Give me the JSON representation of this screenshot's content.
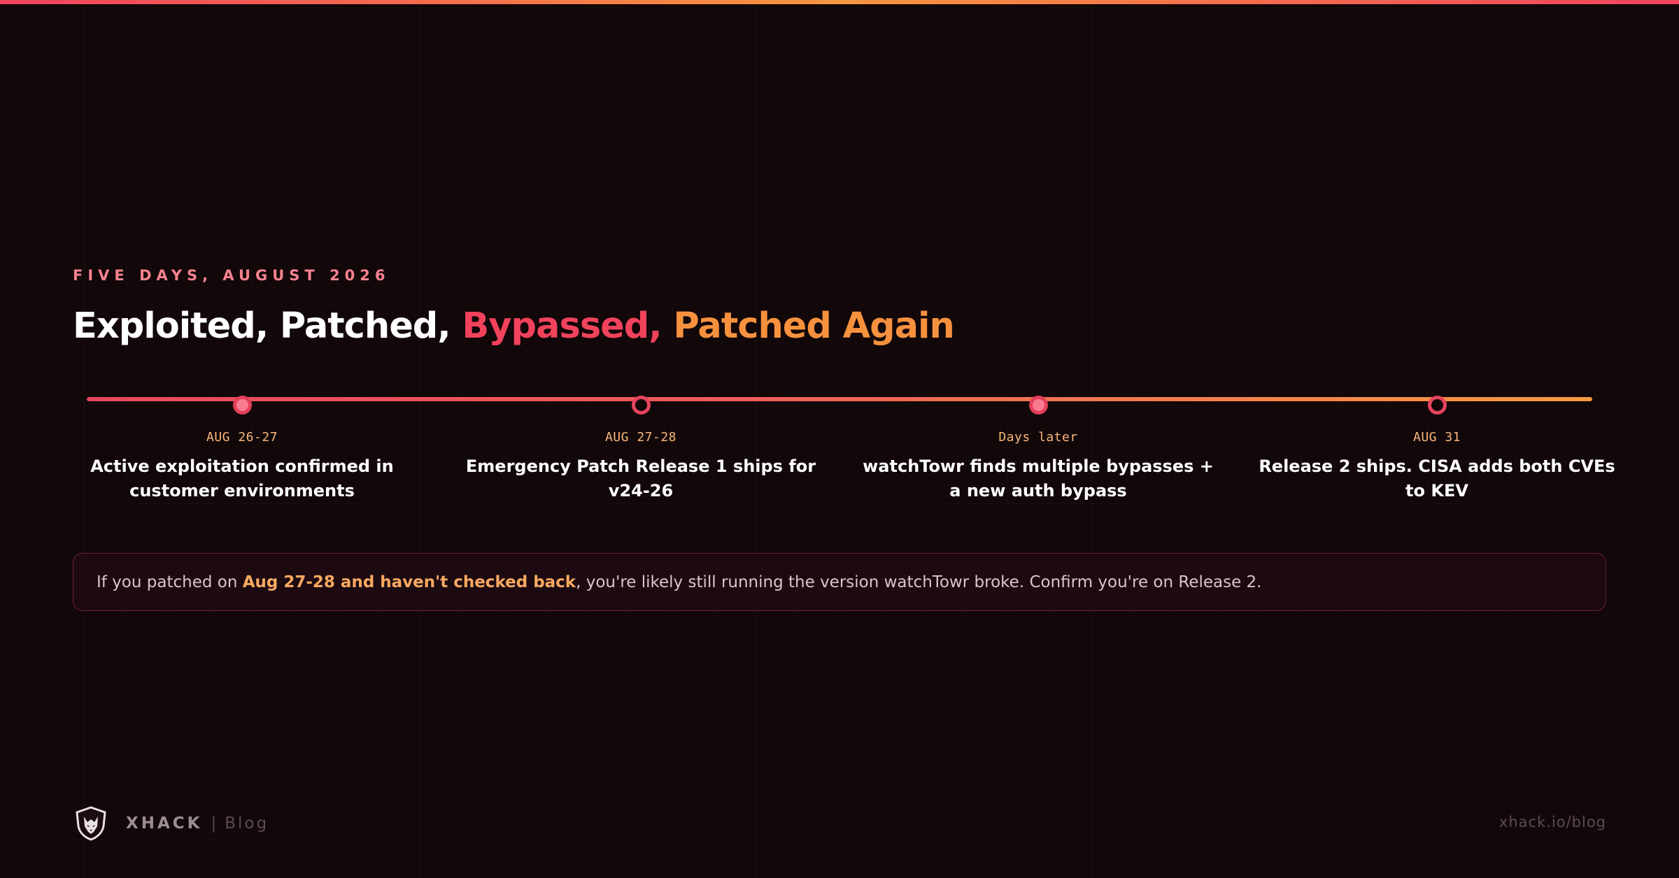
{
  "header": {
    "eyebrow": "FIVE DAYS, AUGUST 2026",
    "headline": {
      "part1": "Exploited, Patched, ",
      "part2": "Bypassed, ",
      "part3": "Patched Again"
    }
  },
  "timeline": {
    "items": [
      {
        "date": "AUG 26-27",
        "text": "Active exploitation confirmed in customer environments",
        "dot": "filled"
      },
      {
        "date": "AUG 27-28",
        "text": "Emergency Patch Release 1 ships for v24-26",
        "dot": "hollow"
      },
      {
        "date": "Days later",
        "text": "watchTowr finds multiple bypasses + a new auth bypass",
        "dot": "filled"
      },
      {
        "date": "AUG 31",
        "text": "Release 2 ships. CISA adds both CVEs to KEV",
        "dot": "hollow"
      }
    ]
  },
  "callout": {
    "prefix": "If you patched on ",
    "highlight": "Aug 27-28 and haven't checked back",
    "suffix": ", you're likely still running the version watchTowr broke. Confirm you're on Release 2."
  },
  "footer": {
    "logo_icon": "wolf-shield-icon",
    "brand": "XHACK",
    "separator": "|",
    "section": "Blog",
    "url": "xhack.io/blog"
  },
  "colors": {
    "accent_red": "#f2425c",
    "accent_orange": "#f7913e",
    "date_color": "#f9b77a",
    "background": "#120709"
  }
}
